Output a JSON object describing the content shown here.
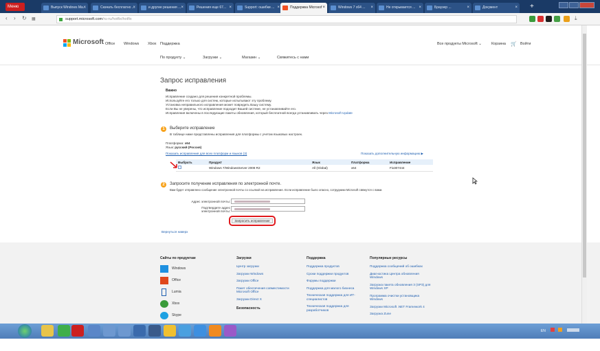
{
  "browser": {
    "menu_label": "Меню",
    "tabs": [
      {
        "label": "Выпуск Windows Ma...",
        "active": false
      },
      {
        "label": "Скачать бесплатно ...",
        "active": false
      },
      {
        "label": "и другие решения ...",
        "active": false
      },
      {
        "label": "Решения еще 67...",
        "active": false
      },
      {
        "label": "Support: ошибки ...",
        "active": false
      },
      {
        "label": "Поддержка Microsof",
        "active": true
      },
      {
        "label": "Windows 7 x64 ...",
        "active": false
      },
      {
        "label": "Не открывается ...",
        "active": false
      },
      {
        "label": "Браузер ...",
        "active": false
      },
      {
        "label": "Документ",
        "active": false
      }
    ],
    "url_domain": "support.microsoft.com",
    "url_path": "/ru-ru/hotfix/hotfix"
  },
  "header": {
    "logo_text": "Microsoft",
    "nav": [
      "Office",
      "Windows",
      "Xbox",
      "Поддержка"
    ],
    "all_products": "Все продукты Microsoft ⌄",
    "cart": "Корзина",
    "signin": "Войти",
    "subnav": [
      "По продукту ⌄",
      "Загрузки ⌄",
      "Магазин ⌄",
      "Свяжитесь с нами"
    ]
  },
  "page": {
    "title": "Запрос исправления",
    "important_label": "Важно",
    "important_lines": [
      "Исправление создано для решения конкретной проблемы.",
      "Используйте его только для систем, которые испытывают эту проблему.",
      "Установка неправильного исправления может повредить Вашу систему.",
      "Если Вы не уверены, что исправление подходит Вашей системе, не устанавливайте его.",
      "Исправления включены в последующие пакеты обновления, который бесплатной всегда устанавливать через "
    ],
    "microsoft_update": "Microsoft Update",
    "step1_title": "Выберите исправление",
    "step1_desc": "В таблице ниже представлены исправления для платформы с учетом языковых настроек.",
    "platform_label": "Платформа:",
    "platform_value": "x64",
    "language_label": "Язык:",
    "language_value": "русский (Россия)",
    "show_all_link": "Показать исправления для всех платформ и языков (3)",
    "more_info_link": "Показать дополнительную информацию ▶",
    "table_headers": [
      "Выбрать",
      "Продукт",
      "Язык",
      "Платформа",
      "Исправление"
    ],
    "table_rows": [
      {
        "product": "Windows 7/WindowsServer 2008 R2",
        "language": "All (Global)",
        "platform": "x64",
        "fix": "Fix307444"
      }
    ],
    "step2_title": "Запросите получение исправления по электронной почте.",
    "step2_desc": "Вам будет отправлено сообщение электронной почты со ссылкой на исправление. Если исправление было опасно, сотрудники Microsoft свяжутся с вами.",
    "email_label": "Адрес электронной почты:",
    "confirm_label_1": "Подтвердите адрес",
    "confirm_label_2": "электронной почты:",
    "submit_label": "Запросить исправление",
    "back_to_top": "Вернуться наверх"
  },
  "footer": {
    "col1_title": "Сайты по продуктам",
    "products": [
      "Windows",
      "Office",
      "Lumia",
      "Xbox",
      "Skype"
    ],
    "col2_title": "Загрузки",
    "col2_items": [
      "Центр загрузки",
      "Загрузки Windows",
      "Загрузки Office",
      "Пакет обеспечения совместимости Microsoft Office",
      "Загрузки Direct X"
    ],
    "col2_title2": "Безопасность",
    "col3_title": "Поддержка",
    "col3_items": [
      "Поддержка продуктов",
      "Сроки поддержки продуктов",
      "Форумы поддержки",
      "Поддержка для малого бизнеса",
      "Техническая поддержка для ИТ-специалистов",
      "Техническая поддержка для разработчиков"
    ],
    "col4_title": "Популярные ресурсы",
    "col4_items": [
      "Поддержка сообщений об ошибках",
      "Диагностика Центра обновления Windows",
      "Загрузка пакета обновления 3 (SP3) для Windows XP",
      "Программа очистки установщика Windows",
      "Загрузки Microsoft .NET Framework 4",
      "Загрузка Zune"
    ]
  },
  "taskbar": {
    "tray_text": "EN"
  }
}
